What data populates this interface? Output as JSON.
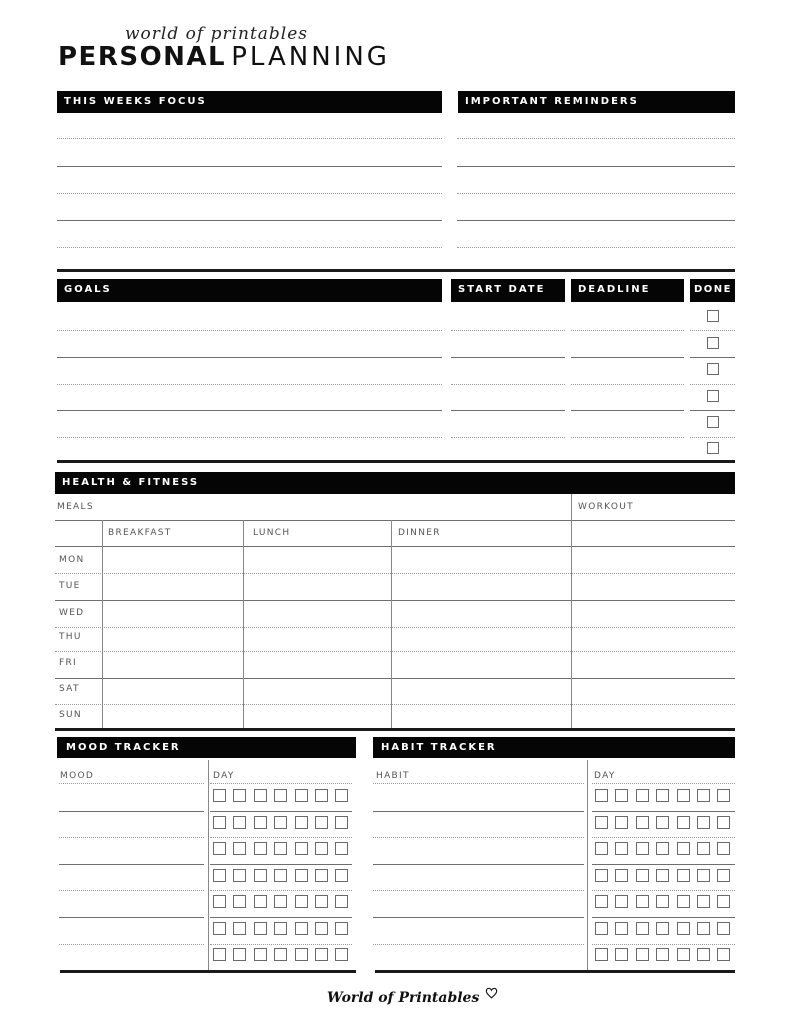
{
  "header": {
    "brand_script": "world of printables",
    "title_bold": "PERSONAL",
    "title_light": "PLANNING"
  },
  "focus": {
    "title": "THIS WEEKS FOCUS"
  },
  "reminders": {
    "title": "IMPORTANT REMINDERS"
  },
  "goals": {
    "title": "GOALS",
    "start_date": "START DATE",
    "deadline": "DEADLINE",
    "done": "DONE",
    "rows": 6
  },
  "health": {
    "title": "HEALTH & FITNESS",
    "meals_label": "MEALS",
    "workout_label": "WORKOUT",
    "columns": [
      "BREAKFAST",
      "LUNCH",
      "DINNER"
    ],
    "days": [
      "MON",
      "TUE",
      "WED",
      "THU",
      "FRI",
      "SAT",
      "SUN"
    ]
  },
  "mood": {
    "title": "MOOD TRACKER",
    "col_label": "MOOD",
    "day_label": "DAY"
  },
  "habit": {
    "title": "HABIT TRACKER",
    "col_label": "HABIT",
    "day_label": "DAY"
  },
  "tracker_rows": 7,
  "tracker_days": 7,
  "footer": {
    "brand": "World of Printables",
    "icon": "heart-icon"
  }
}
